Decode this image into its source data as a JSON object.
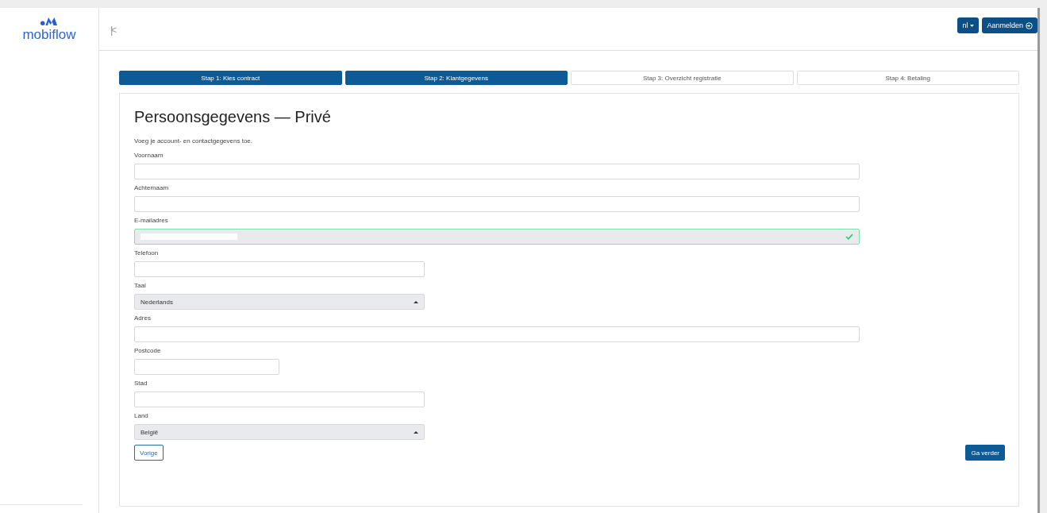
{
  "logo": {
    "text": "mobiflow"
  },
  "header": {
    "collapse_glyph": "|<",
    "language": "nl",
    "login": "Aanmelden"
  },
  "steps": [
    {
      "label": "Stap 1: Kies contract",
      "selected": true
    },
    {
      "label": "Stap 2: Klantgegevens",
      "selected": true
    },
    {
      "label": "Stap 3: Overzicht registratie",
      "selected": false
    },
    {
      "label": "Stap 4: Betaling",
      "selected": false
    }
  ],
  "form": {
    "title": "Persoonsgegevens — Privé",
    "intro": "Voeg je account- en contactgegevens toe.",
    "fields": [
      {
        "label": "Voornaam",
        "kind": "text"
      },
      {
        "label": "Achternaam",
        "kind": "text"
      },
      {
        "label": "E-mailadres",
        "kind": "text",
        "valid": true,
        "redacted": true
      },
      {
        "label": "Telefoon",
        "kind": "text"
      },
      {
        "label": "Taal",
        "kind": "select",
        "value": "Nederlands"
      },
      {
        "label": "Adres",
        "kind": "text"
      },
      {
        "label": "Postcode",
        "kind": "text"
      },
      {
        "label": "Stad",
        "kind": "text"
      },
      {
        "label": "Land",
        "kind": "select",
        "value": "België"
      }
    ],
    "back": "Vorige",
    "next": "Ga verder"
  }
}
